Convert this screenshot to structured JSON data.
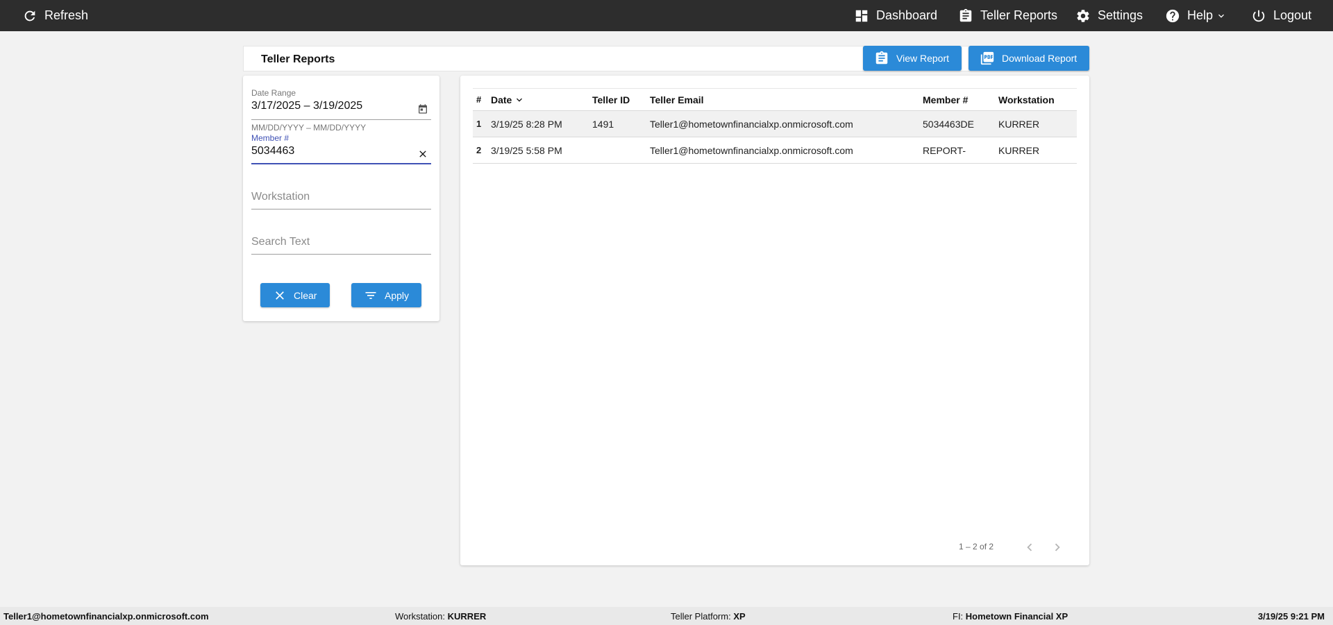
{
  "topbar": {
    "refresh": "Refresh",
    "dashboard": "Dashboard",
    "teller_reports": "Teller Reports",
    "settings": "Settings",
    "help": "Help",
    "logout": "Logout"
  },
  "header": {
    "title": "Teller Reports",
    "view_report": "View Report",
    "download_report": "Download Report"
  },
  "filters": {
    "date_range_label": "Date Range",
    "date_range_value": "3/17/2025 – 3/19/2025",
    "date_range_hint": "MM/DD/YYYY – MM/DD/YYYY",
    "member_label": "Member #",
    "member_value": "5034463",
    "workstation_placeholder": "Workstation",
    "search_placeholder": "Search Text",
    "clear": "Clear",
    "apply": "Apply"
  },
  "table": {
    "columns": [
      "#",
      "Date",
      "Teller ID",
      "Teller Email",
      "Member #",
      "Workstation"
    ],
    "rows": [
      {
        "idx": "1",
        "date": "3/19/25 8:28 PM",
        "teller_id": "1491",
        "email": "Teller1@hometownfinancialxp.onmicrosoft.com",
        "member": "5034463DE",
        "workstation": "KURRER"
      },
      {
        "idx": "2",
        "date": "3/19/25 5:58 PM",
        "teller_id": "",
        "email": "Teller1@hometownfinancialxp.onmicrosoft.com",
        "member": "REPORT-",
        "workstation": "KURRER"
      }
    ],
    "pager": "1 – 2 of 2"
  },
  "footer": {
    "user": "Teller1@hometownfinancialxp.onmicrosoft.com",
    "workstation_label": "Workstation:",
    "workstation_value": "KURRER",
    "platform_label": "Teller Platform:",
    "platform_value": "XP",
    "fi_label": "FI:",
    "fi_value": "Hometown Financial XP",
    "datetime": "3/19/25 9:21 PM"
  },
  "colors": {
    "topbar": "#2d2d2d",
    "accent": "#2b8ad8",
    "focus": "#3f51b5"
  }
}
